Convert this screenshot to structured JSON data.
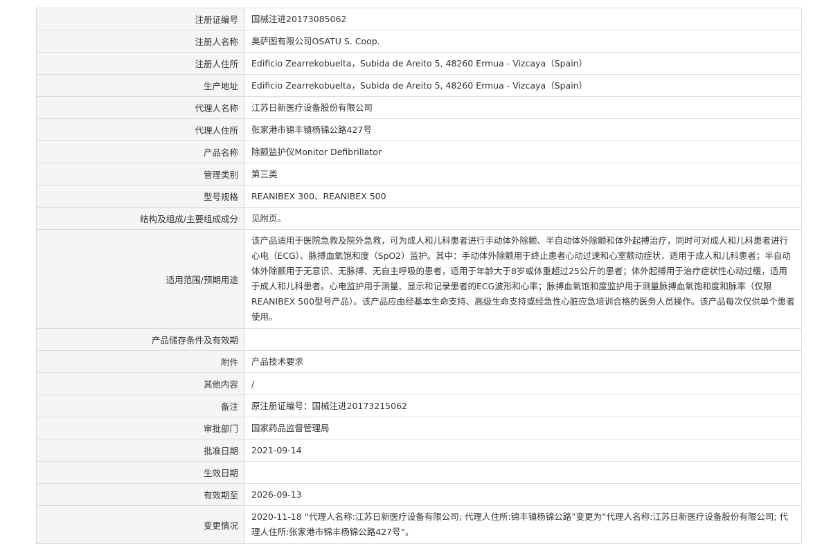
{
  "rows": [
    {
      "label": "注册证编号",
      "value": "国械注进20173085062"
    },
    {
      "label": "注册人名称",
      "value": "奥萨图有限公司OSATU S. Coop."
    },
    {
      "label": "注册人住所",
      "value": "Edificio Zearrekobuelta，Subida de Areito 5, 48260 Ermua - Vizcaya（Spain）"
    },
    {
      "label": "生产地址",
      "value": "Edificio Zearrekobuelta，Subida de Areito 5, 48260 Ermua - Vizcaya（Spain）"
    },
    {
      "label": "代理人名称",
      "value": "江苏日新医疗设备股份有限公司"
    },
    {
      "label": "代理人住所",
      "value": "张家港市锦丰镇杨锦公路427号"
    },
    {
      "label": "产品名称",
      "value": "除颤监护仪Monitor Defibrillator"
    },
    {
      "label": "管理类别",
      "value": "第三类"
    },
    {
      "label": "型号规格",
      "value": "REANIBEX 300、REANIBEX 500"
    },
    {
      "label": "结构及组成/主要组成成分",
      "value": "见附页。"
    },
    {
      "label": "适用范围/预期用途",
      "value": "该产品适用于医院急救及院外急救，可为成人和儿科患者进行手动体外除颤、半自动体外除颤和体外起搏治疗，同时可对成人和儿科患者进行心电（ECG）、脉搏血氧饱和度（SpO2）监护。其中：手动体外除颤用于终止患者心动过速和心室颤动症状，适用于成人和儿科患者；半自动体外除颤用于无意识、无脉搏、无自主呼吸的患者，适用于年龄大于8岁或体重超过25公斤的患者；体外起搏用于治疗症状性心动过缓，适用于成人和儿科患者。心电监护用于测量、显示和记录患者的ECG波形和心率；脉搏血氧饱和度监护用于测量脉搏血氧饱和度和脉率（仅限REANIBEX 500型号产品）。该产品应由经基本生命支持、高级生命支持或经急性心脏应急培训合格的医务人员操作。该产品每次仅供单个患者使用。"
    },
    {
      "label": "产品储存条件及有效期",
      "value": ""
    },
    {
      "label": "附件",
      "value": "产品技术要求"
    },
    {
      "label": "其他内容",
      "value": "/"
    },
    {
      "label": "备注",
      "value": "原注册证编号：国械注进20173215062"
    },
    {
      "label": "审批部门",
      "value": "国家药品监督管理局"
    },
    {
      "label": "批准日期",
      "value": "2021-09-14"
    },
    {
      "label": "生效日期",
      "value": ""
    },
    {
      "label": "有效期至",
      "value": "2026-09-13"
    },
    {
      "label": "变更情况",
      "value": "2020-11-18 “代理人名称:江苏日新医疗设备有限公司; 代理人住所:锦丰镇杨锦公路”变更为“代理人名称:江苏日新医疗设备股份有限公司; 代理人住所:张家港市锦丰杨锦公路427号”。"
    }
  ]
}
